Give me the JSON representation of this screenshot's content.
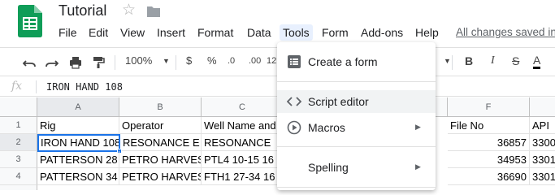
{
  "app": {
    "title": "Tutorial",
    "saved_status": "All changes saved in"
  },
  "menu": [
    "File",
    "Edit",
    "View",
    "Insert",
    "Format",
    "Data",
    "Tools",
    "Form",
    "Add-ons",
    "Help"
  ],
  "toolbar": {
    "zoom": "100%",
    "currency": "$",
    "percent": "%",
    "dec_decrease": ".0",
    "dec_increase": ".00",
    "more_formats": "12",
    "bold": "B",
    "italic": "I",
    "strike": "S",
    "text_color": "A"
  },
  "formula_bar": {
    "fx": "fx",
    "value": "IRON HAND 108"
  },
  "columns": [
    "A",
    "B",
    "C",
    "",
    "",
    "F",
    "API"
  ],
  "col_headers": [
    "A",
    "B",
    "C",
    "F"
  ],
  "rows": [
    {
      "num": "1",
      "a": "Rig",
      "b": "Operator",
      "c": "Well Name and",
      "f": "File No",
      "g": "API"
    },
    {
      "num": "2",
      "a": "IRON HAND 108",
      "b": "RESONANCE E",
      "c": "RESONANCE",
      "f": "36857",
      "g": "3300"
    },
    {
      "num": "3",
      "a": "PATTERSON 28",
      "b": "PETRO HARVES",
      "c": "PTL4 10-15 16",
      "f": "34953",
      "g": "3301"
    },
    {
      "num": "4",
      "a": "PATTERSON 34",
      "b": "PETRO HARVES",
      "c": "FTH1 27-34 16",
      "f": "36690",
      "g": "3301"
    }
  ],
  "tools_menu": {
    "items": [
      {
        "label": "Create a form",
        "icon": "form-icon"
      },
      {
        "label": "Script editor",
        "icon": "code-icon"
      },
      {
        "label": "Macros",
        "icon": "play-circle-icon",
        "submenu": true
      },
      {
        "label": "Spelling",
        "icon": "",
        "submenu": true
      }
    ]
  },
  "colors": {
    "accent": "#1a73e8",
    "sheets_green": "#0f9d58",
    "menu_active_bg": "#e8f0fe"
  }
}
